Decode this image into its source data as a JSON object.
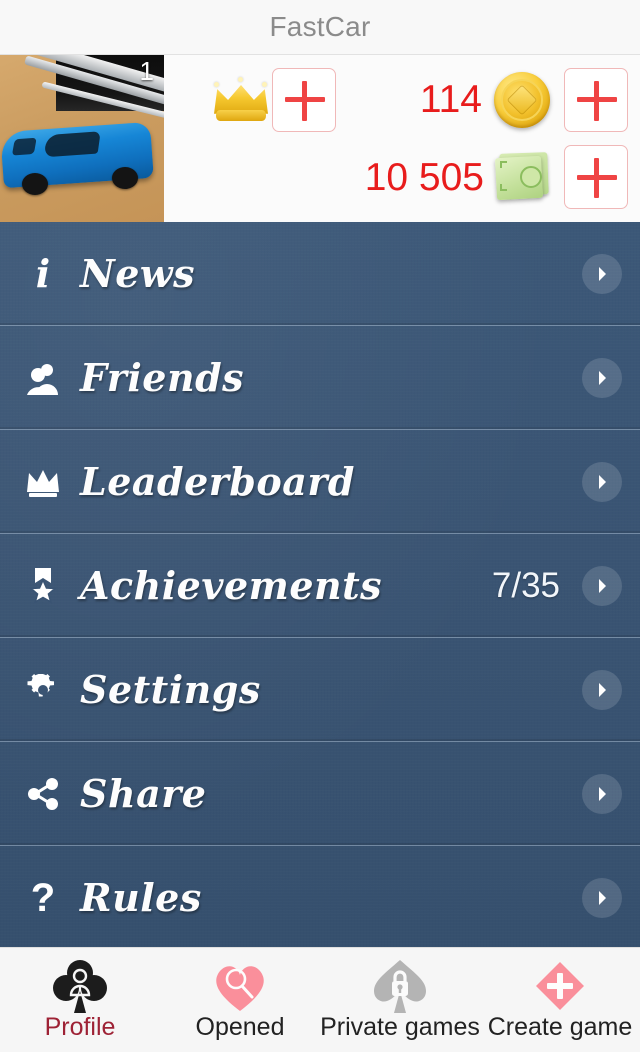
{
  "app": {
    "title": "FastCar"
  },
  "header": {
    "avatar": {
      "name": "user-avatar-photo",
      "badge": "1",
      "description": "blue toy car photo"
    },
    "vip": {
      "icon": "crown-icon",
      "add_label": "+"
    },
    "coins": {
      "icon": "gold-coin-icon",
      "amount": "114",
      "add_label": "+"
    },
    "money": {
      "icon": "banknote-icon",
      "amount": "10 505",
      "add_label": "+"
    },
    "accent_red": "#e81c1c",
    "plus_border": "#f0b8b8"
  },
  "menu": {
    "items": [
      {
        "icon": "info-icon",
        "label": "News",
        "value": ""
      },
      {
        "icon": "friends-icon",
        "label": "Friends",
        "value": ""
      },
      {
        "icon": "crown-icon",
        "label": "Leaderboard",
        "value": ""
      },
      {
        "icon": "medal-star-icon",
        "label": "Achievements",
        "value": "7/35"
      },
      {
        "icon": "gear-icon",
        "label": "Settings",
        "value": ""
      },
      {
        "icon": "share-icon",
        "label": "Share",
        "value": ""
      },
      {
        "icon": "question-icon",
        "label": "Rules",
        "value": ""
      }
    ],
    "background": "#3a5473",
    "chevron": "chevron-right-icon"
  },
  "tabbar": {
    "tabs": [
      {
        "icon": "club-person-icon",
        "label": "Profile",
        "active": true,
        "color": "#1c1c1c"
      },
      {
        "icon": "heart-search-icon",
        "label": "Opened",
        "active": false,
        "color": "#fa8f9b"
      },
      {
        "icon": "spade-lock-icon",
        "label": "Private games",
        "active": false,
        "color": "#b4b4b4"
      },
      {
        "icon": "diamond-plus-icon",
        "label": "Create game",
        "active": false,
        "color": "#fa8f9b"
      }
    ],
    "active_color": "#9e2235"
  }
}
